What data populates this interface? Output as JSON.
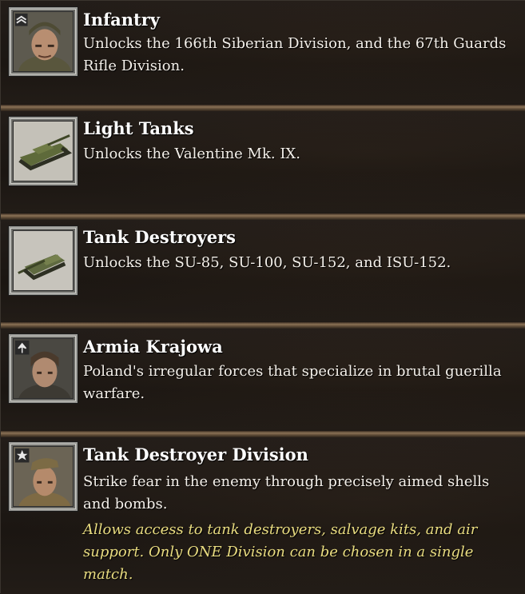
{
  "items": [
    {
      "title": "Infantry",
      "description": "Unlocks the 166th Siberian Division, and the 67th Guards Rifle Division.",
      "icon": "soviet-infantry-portrait-icon"
    },
    {
      "title": "Light Tanks",
      "description": "Unlocks the Valentine Mk. IX.",
      "icon": "light-tank-icon"
    },
    {
      "title": "Tank Destroyers",
      "description": "Unlocks the SU-85, SU-100, SU-152, and ISU-152.",
      "icon": "tank-destroyer-icon"
    },
    {
      "title": "Armia Krajowa",
      "description": "Poland's irregular forces that specialize in brutal guerilla warfare.",
      "icon": "polish-partisan-portrait-icon"
    },
    {
      "title": "Tank Destroyer Division",
      "description": "Strike fear in the enemy through precisely aimed shells and bombs.",
      "note": "Allows access to tank destroyers, salvage kits, and air support. Only ONE Division can be chosen in a single match.",
      "icon": "soviet-officer-portrait-icon"
    }
  ],
  "colors": {
    "title": "#ffffff",
    "description": "#f4f0ea",
    "note": "#e9dc80",
    "background": "#1d1916"
  }
}
